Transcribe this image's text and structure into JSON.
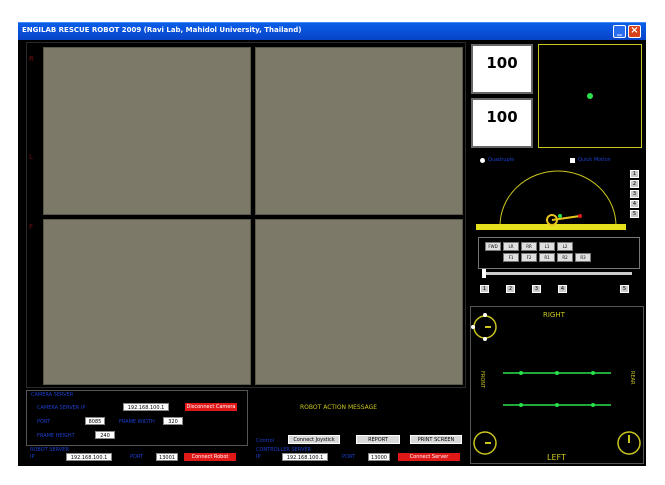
{
  "window": {
    "title": "ENGILAB RESCUE ROBOT 2009 (Ravi Lab, Mahidol University, Thailand)",
    "minimize_icon": "minimize-icon",
    "close_icon": "close-icon",
    "titlebar_color": "#0a5ee8"
  },
  "colors": {
    "accent_red": "#e01818",
    "label_blue": "#1c3fd0",
    "text_yellow": "#c9c51d",
    "indicator_green": "#2be04a",
    "camera_gray": "#7d7968"
  },
  "gauges": {
    "value_1": "100",
    "value_2": "100"
  },
  "arm_view": {
    "radio_1": "Quadruple",
    "radio_2": "Quick Motion"
  },
  "preset_buttons": [
    "1",
    "2",
    "3",
    "4",
    "5"
  ],
  "direction_pad": [
    "FWD",
    "LR",
    "RR",
    "L1",
    "L2",
    "F1",
    "F2",
    "R1",
    "R2",
    "R3"
  ],
  "bottom_buttons": [
    "1",
    "2",
    "3",
    "4",
    "5"
  ],
  "track_view": {
    "right_label": "RIGHT",
    "left_label": "LEFT",
    "front_text": "FRONT",
    "rear_text": "REAR"
  },
  "settings": {
    "header": "CAMERA SERVER",
    "server_label": "CAMERA SERVER IP",
    "server_ip": "192.168.100.1",
    "server_button": "Disconnect Camera",
    "port_label": "PORT",
    "port_value": "8085",
    "width_label": "FRAME WIDTH",
    "width_value": "320",
    "height_label": "FRAME HEIGHT",
    "height_value": "240"
  },
  "robot_connection": {
    "header": "ROBOT SERVER",
    "ip_label": "IP",
    "ip_value": "192.168.100.1",
    "port_label": "PORT",
    "port_value": "13001",
    "connect_button": "Connect Robot"
  },
  "message": {
    "title": "ROBOT ACTION MESSAGE",
    "control_label": "Control",
    "button_1": "Connect Joystick",
    "button_2": "REPORT",
    "button_3": "PRINT SCREEN"
  },
  "relay_connection": {
    "header": "CONTROLLER SERVER",
    "ip_label": "IP",
    "ip_value": "192.168.100.1",
    "port_label": "PORT",
    "port_value": "13000",
    "connect_button": "Connect Server"
  }
}
